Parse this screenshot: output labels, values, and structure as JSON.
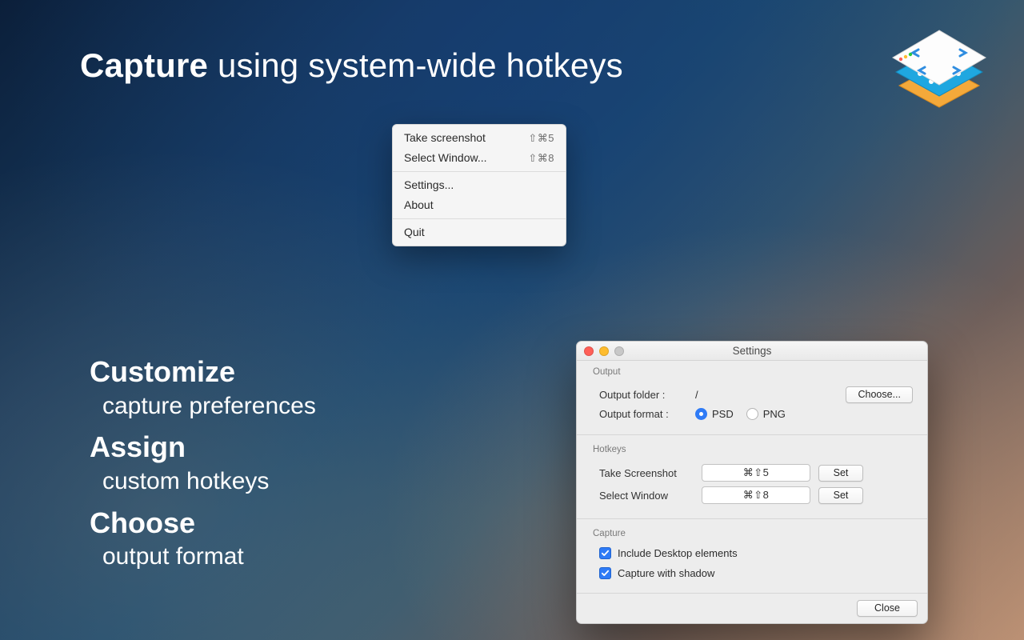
{
  "heading": {
    "strong": "Capture",
    "rest": " using system-wide hotkeys"
  },
  "features": [
    {
      "strong": "Customize",
      "sub": "capture preferences"
    },
    {
      "strong": "Assign",
      "sub": "custom hotkeys"
    },
    {
      "strong": "Choose",
      "sub": "output format"
    }
  ],
  "menu": {
    "items_top": [
      {
        "label": "Take screenshot",
        "shortcut": "⇧⌘5"
      },
      {
        "label": "Select Window...",
        "shortcut": "⇧⌘8"
      }
    ],
    "items_mid": [
      {
        "label": "Settings..."
      },
      {
        "label": "About"
      }
    ],
    "item_quit": {
      "label": "Quit"
    }
  },
  "settings": {
    "title": "Settings",
    "output": {
      "group_label": "Output",
      "folder_label": "Output folder :",
      "folder_value": "/",
      "choose_button": "Choose...",
      "format_label": "Output format :",
      "format_options": [
        {
          "label": "PSD",
          "selected": true
        },
        {
          "label": "PNG",
          "selected": false
        }
      ]
    },
    "hotkeys": {
      "group_label": "Hotkeys",
      "rows": [
        {
          "label": "Take Screenshot",
          "value": "⌘⇧5",
          "button": "Set"
        },
        {
          "label": "Select Window",
          "value": "⌘⇧8",
          "button": "Set"
        }
      ]
    },
    "capture": {
      "group_label": "Capture",
      "checks": [
        {
          "label": "Include Desktop elements",
          "checked": true
        },
        {
          "label": "Capture with shadow",
          "checked": true
        }
      ]
    },
    "close_button": "Close"
  }
}
